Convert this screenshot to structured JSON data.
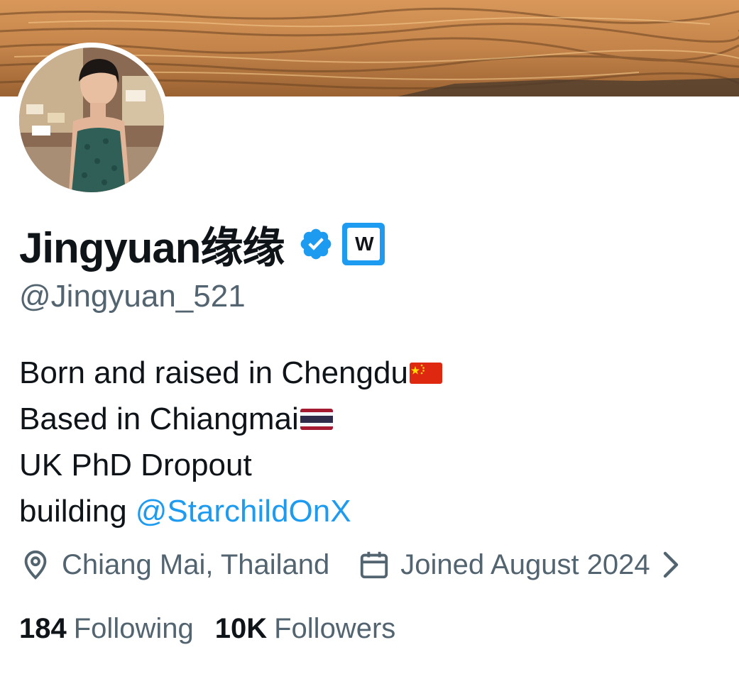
{
  "profile": {
    "display_name": "Jingyuan缘缘",
    "handle": "@Jingyuan_521",
    "verified_icon": "verified-badge-icon",
    "affiliation_badge_text": "W",
    "bio": {
      "line1": "Born and raised in Chengdu",
      "line1_flag": "🇨🇳",
      "line2": "Based in Chiangmai",
      "line2_flag": "🇹🇭",
      "line3": "UK PhD Dropout",
      "line4_prefix": "building",
      "line4_mention": "@StarchildOnX"
    },
    "location": "Chiang Mai, Thailand",
    "joined": "Joined August 2024",
    "following_count": "184",
    "following_label": "Following",
    "followers_count": "10K",
    "followers_label": "Followers"
  },
  "colors": {
    "accent": "#1d9bf0",
    "text_primary": "#0f1419",
    "text_secondary": "#536471",
    "flag_china_red": "#de2910",
    "flag_china_yellow": "#ffde00",
    "flag_thailand_red": "#a51931",
    "flag_thailand_blue": "#2d2a4a"
  }
}
